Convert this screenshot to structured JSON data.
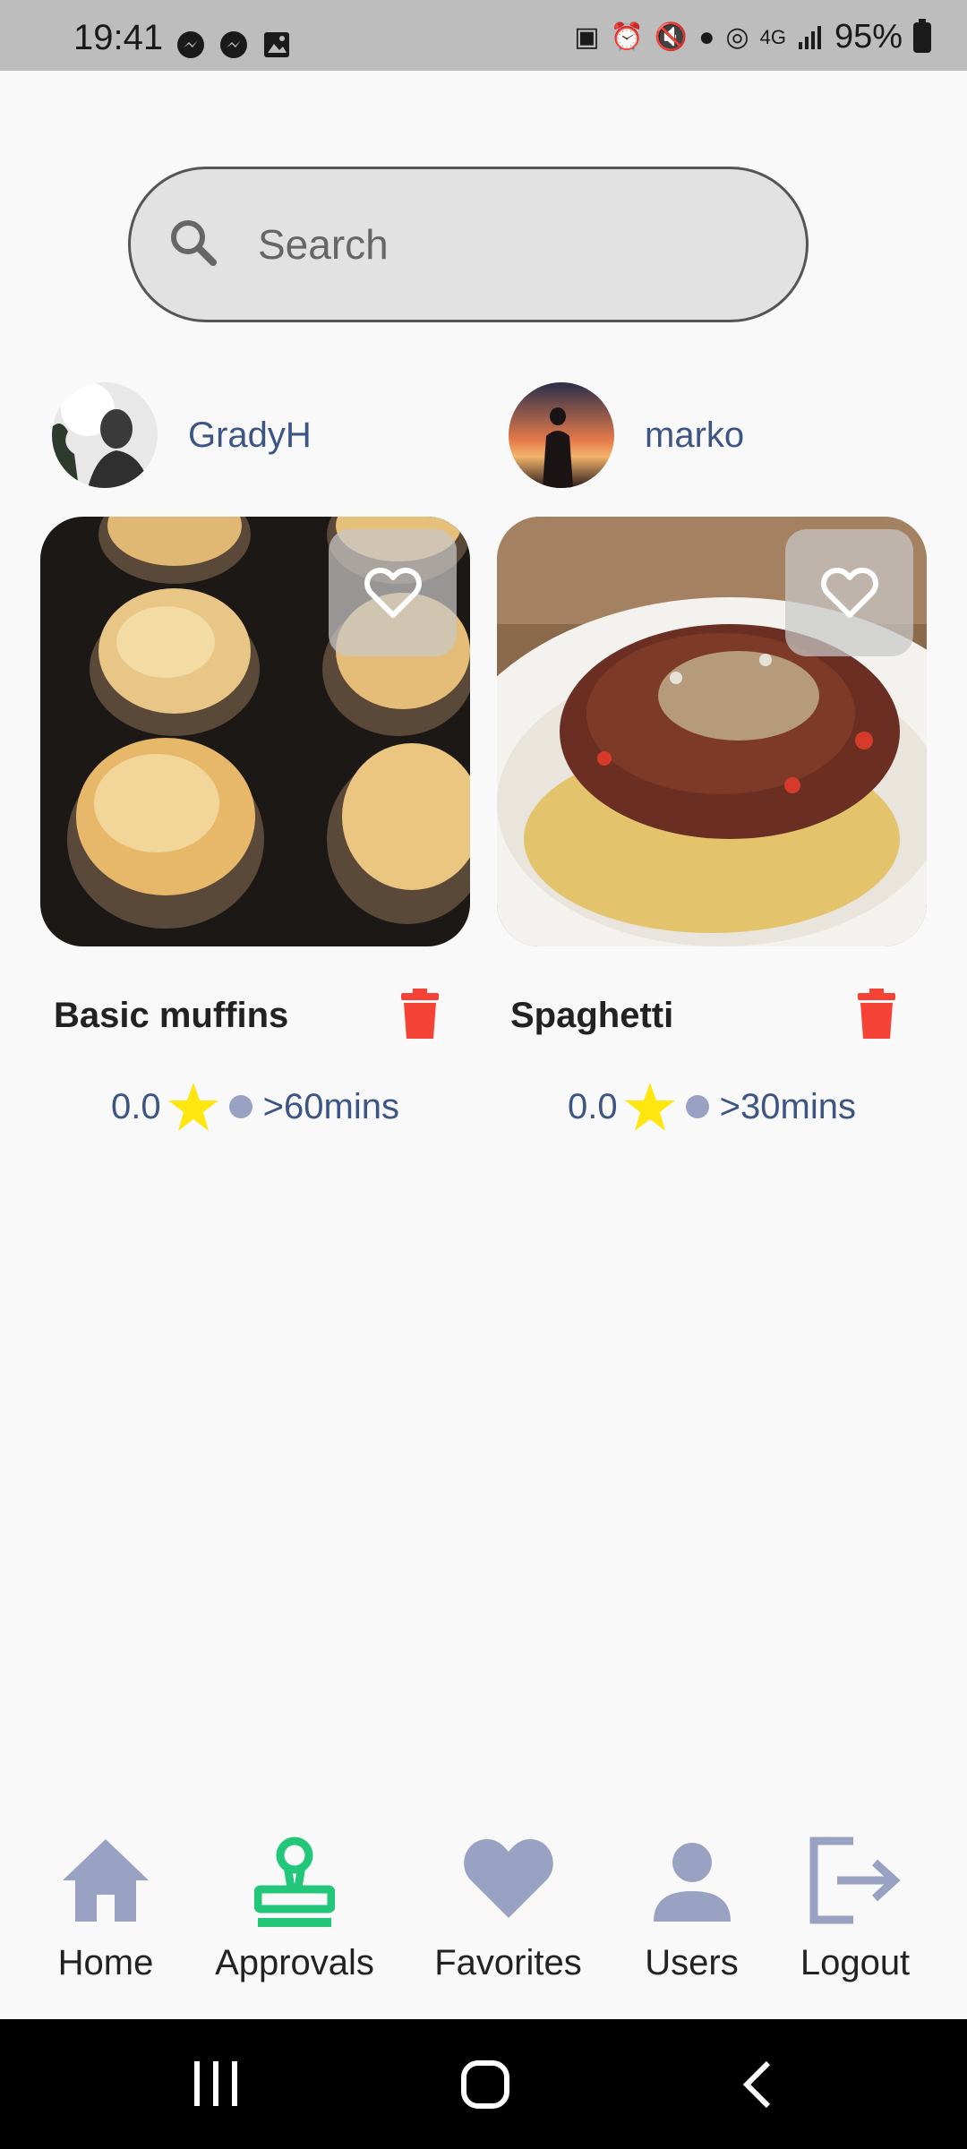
{
  "status_bar": {
    "time": "19:41",
    "battery": "95%",
    "left_icons": [
      "messenger-icon",
      "messenger-icon",
      "gallery-icon"
    ],
    "right_icons": [
      "battery-saver-icon",
      "alarm-icon",
      "mute-icon",
      "location-icon",
      "hotspot-icon",
      "4g-icon",
      "signal-icon",
      "battery-icon"
    ]
  },
  "search": {
    "placeholder": "Search",
    "icon": "search-icon"
  },
  "recipes": [
    {
      "author": "GradyH",
      "title": "Basic muffins",
      "rating": "0.0",
      "time": ">60mins"
    },
    {
      "author": "marko",
      "title": "Spaghetti",
      "rating": "0.0",
      "time": ">30mins"
    }
  ],
  "nav": {
    "home": "Home",
    "approvals": "Approvals",
    "favorites": "Favorites",
    "users": "Users",
    "logout": "Logout"
  },
  "colors": {
    "active_nav": "#22c77a",
    "inactive_nav": "#9aa2c4",
    "delete": "#f44336",
    "star": "#ffe60f",
    "author_text": "#3d5585"
  }
}
